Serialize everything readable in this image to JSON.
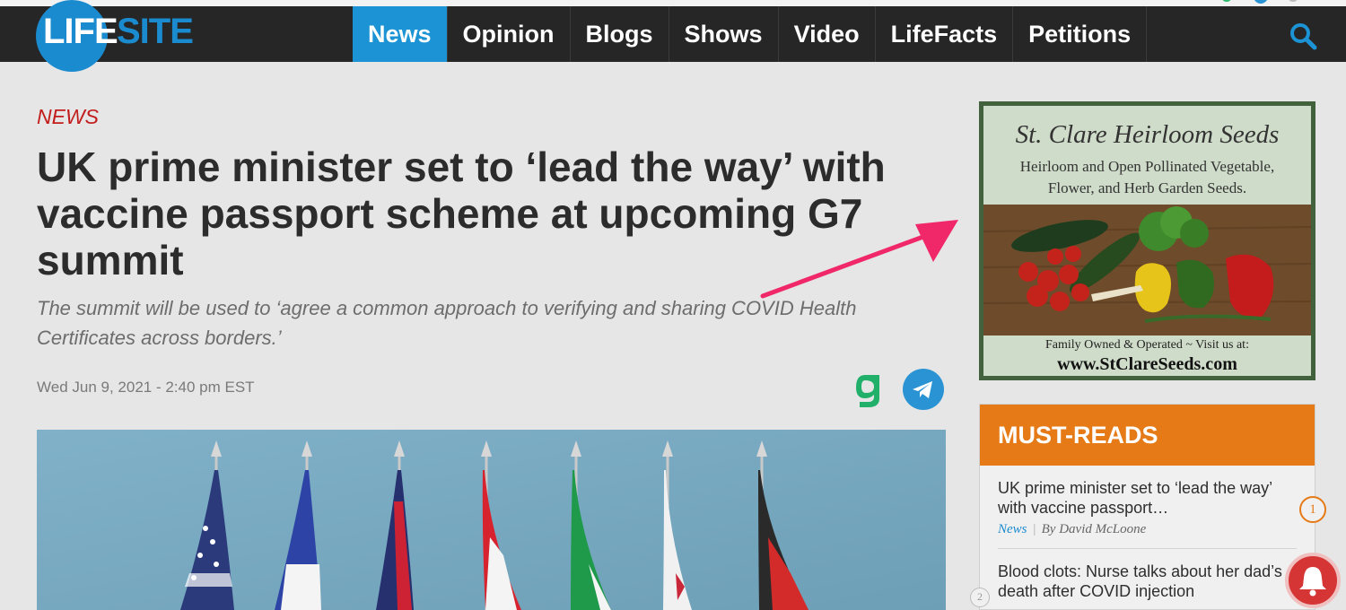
{
  "logo": {
    "part1": "LIFE",
    "part2": "SITE"
  },
  "nav": {
    "items": [
      {
        "label": "News",
        "active": true
      },
      {
        "label": "Opinion",
        "active": false
      },
      {
        "label": "Blogs",
        "active": false
      },
      {
        "label": "Shows",
        "active": false
      },
      {
        "label": "Video",
        "active": false
      },
      {
        "label": "LifeFacts",
        "active": false
      },
      {
        "label": "Petitions",
        "active": false
      }
    ],
    "search_icon": "search-icon"
  },
  "article": {
    "category": "NEWS",
    "headline": "UK prime minister set to ‘lead the way’ with vaccine passport scheme at upcoming G7 summit",
    "subheadline": "The summit will be used to ‘agree a common approach to verifying and sharing COVID Health Certificates across borders.’",
    "dateline": "Wed Jun 9, 2021 - 2:40 pm EST",
    "share_icons": [
      "gab-icon",
      "telegram-icon"
    ]
  },
  "ad": {
    "title": "St. Clare Heirloom Seeds",
    "desc_line1": "Heirloom and Open Pollinated Vegetable,",
    "desc_line2": "Flower, and Herb Garden Seeds.",
    "tagline": "Family Owned & Operated ~ Visit us at:",
    "url": "www.StClareSeeds.com"
  },
  "must_reads": {
    "header": "MUST-READS",
    "items": [
      {
        "number": "1",
        "title": "UK prime minister set to ‘lead the way’ with vaccine passport…",
        "category": "News",
        "separator": "|",
        "byline": "By David McLoone"
      },
      {
        "number": "2",
        "title": "Blood clots: Nurse talks about her dad’s death after COVID injection"
      }
    ]
  },
  "colors": {
    "nav_bg": "#262626",
    "nav_active": "#1b93d4",
    "category_red": "#c21d1d",
    "must_reads_orange": "#e57a16",
    "annotation_arrow": "#f0286a"
  }
}
